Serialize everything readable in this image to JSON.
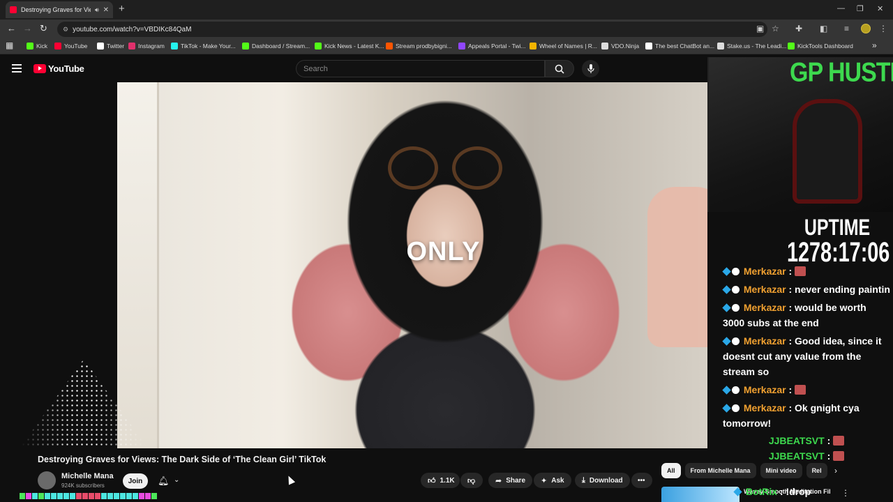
{
  "browser": {
    "tab_title": "Destroying Graves for Views",
    "url": "youtube.com/watch?v=VBDIKc84QaM",
    "bookmarks": [
      {
        "label": "Kick",
        "color": "#53fc18"
      },
      {
        "label": "YouTube",
        "color": "#ff0033"
      },
      {
        "label": "Twitter",
        "color": "#ffffff"
      },
      {
        "label": "Instagram",
        "color": "#e1306c"
      },
      {
        "label": "TikTok - Make Your...",
        "color": "#25f4ee"
      },
      {
        "label": "Dashboard / Stream...",
        "color": "#53fc18"
      },
      {
        "label": "Kick News - Latest K...",
        "color": "#53fc18"
      },
      {
        "label": "Stream prodbybigni...",
        "color": "#ff5500"
      },
      {
        "label": "Appeals Portal - Twi...",
        "color": "#9146ff"
      },
      {
        "label": "Wheel of Names | R...",
        "color": "#f4b400"
      },
      {
        "label": "VDO.Ninja",
        "color": "#dddddd"
      },
      {
        "label": "The best ChatBot an...",
        "color": "#ffffff"
      },
      {
        "label": "Stake.us - The Leadi...",
        "color": "#dddddd"
      },
      {
        "label": "KickTools Dashboard",
        "color": "#53fc18"
      }
    ]
  },
  "youtube": {
    "logo_text": "YouTube",
    "search_placeholder": "Search",
    "video_caption": "ONLY",
    "video_title": "Destroying Graves for Views: The Dark Side of ‘The Clean Girl’ TikTok",
    "channel_name": "Michelle Mana",
    "channel_subs": "924K subscribers",
    "join_label": "Join",
    "like_count": "1.1K",
    "share_label": "Share",
    "ask_label": "Ask",
    "download_label": "Download",
    "chips": [
      "All",
      "From Michelle Mana",
      "Mini video",
      "Rel"
    ],
    "rec_title": "Wavey Smooth Meditation Film - Meditation Relaxing"
  },
  "stream": {
    "webcam_title": "GP HUSTLA",
    "uptime_label": "UPTIME",
    "uptime_value": "1278:17:06",
    "chat": [
      {
        "user": "Merkazar",
        "text": "",
        "emote": true
      },
      {
        "user": "Merkazar",
        "text": "never ending paintin",
        "emote": false
      },
      {
        "user": "Merkazar",
        "text": "would be worth 3000 subs at the end",
        "emote": false
      },
      {
        "user": "Merkazar",
        "text": "Good idea, since it doesnt cut any value from the stream so",
        "emote": false
      },
      {
        "user": "Merkazar",
        "text": "",
        "emote": true
      },
      {
        "user": "Merkazar",
        "text": "Ok gnight cya tomorrow!",
        "emote": false
      }
    ],
    "green_chat": [
      {
        "user": "JJBEATSVT",
        "emote": true
      },
      {
        "user": "JJBEATSVT",
        "emote": true
      }
    ],
    "botrix_user": "BotRix",
    "botrix_text": "!drop"
  }
}
